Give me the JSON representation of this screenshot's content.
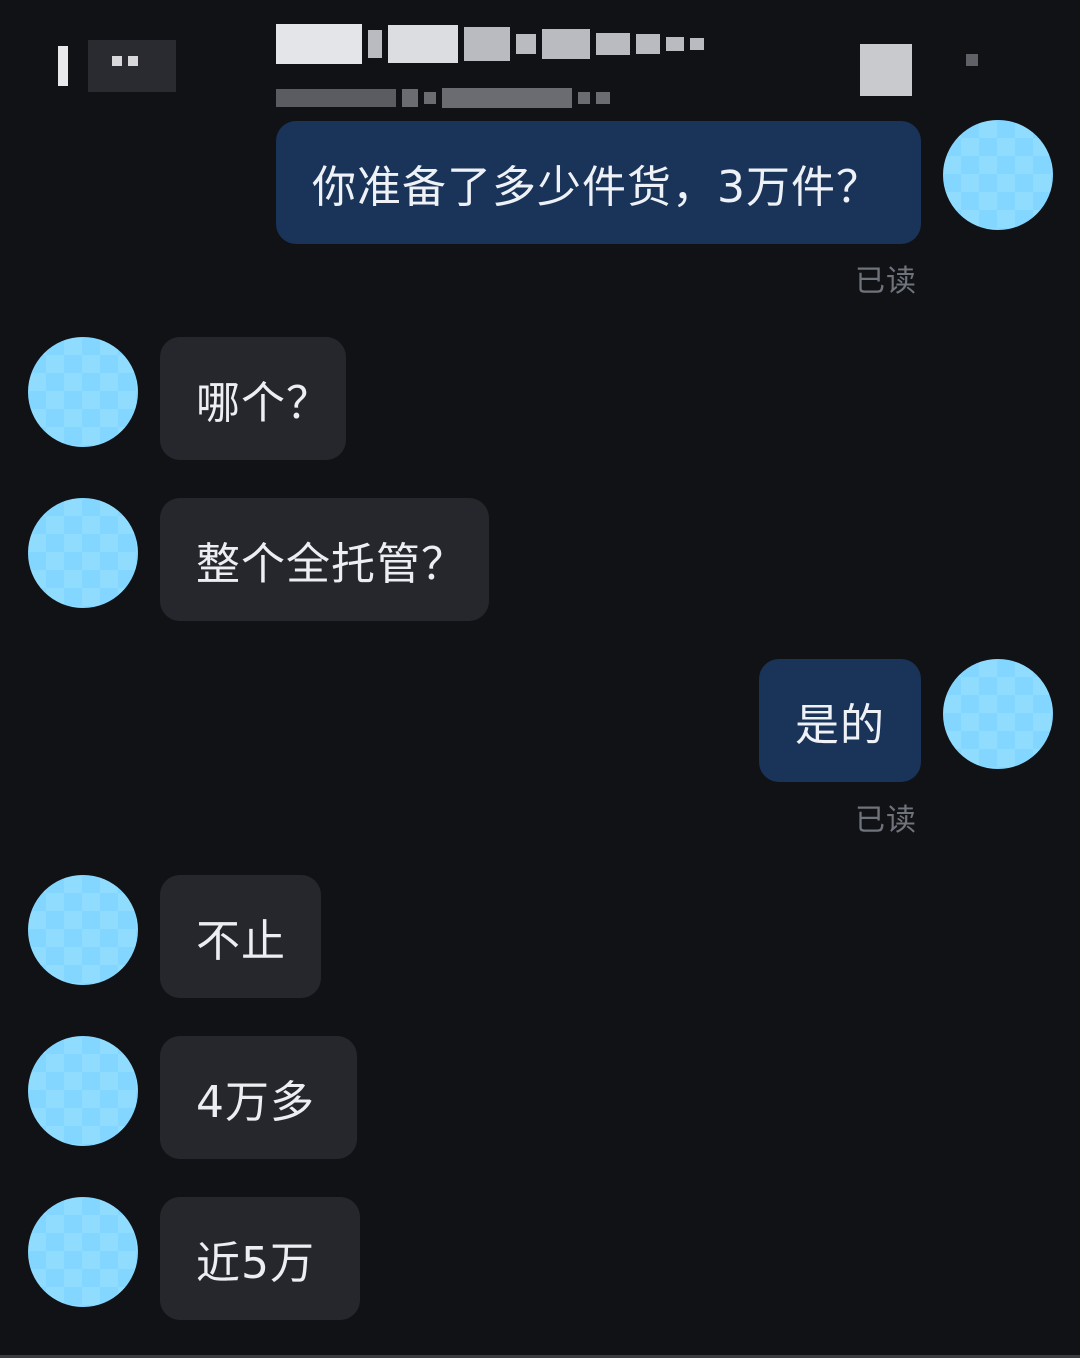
{
  "header": {
    "back_label": "",
    "title_obscured": true
  },
  "messages": [
    {
      "side": "mine",
      "text": "你准备了多少件货，3万件？",
      "status": "已读"
    },
    {
      "side": "theirs",
      "text": "哪个？"
    },
    {
      "side": "theirs",
      "text": "整个全托管？"
    },
    {
      "side": "mine",
      "text": "是的",
      "status": "已读"
    },
    {
      "side": "theirs",
      "text": "不止"
    },
    {
      "side": "theirs",
      "text": "4万多"
    },
    {
      "side": "theirs",
      "text": "近5万"
    }
  ],
  "colors": {
    "background": "#111216",
    "mine_bubble": "#1a3358",
    "theirs_bubble": "#25272d",
    "read_status": "#6f737b",
    "avatar": "#8fdcff"
  }
}
